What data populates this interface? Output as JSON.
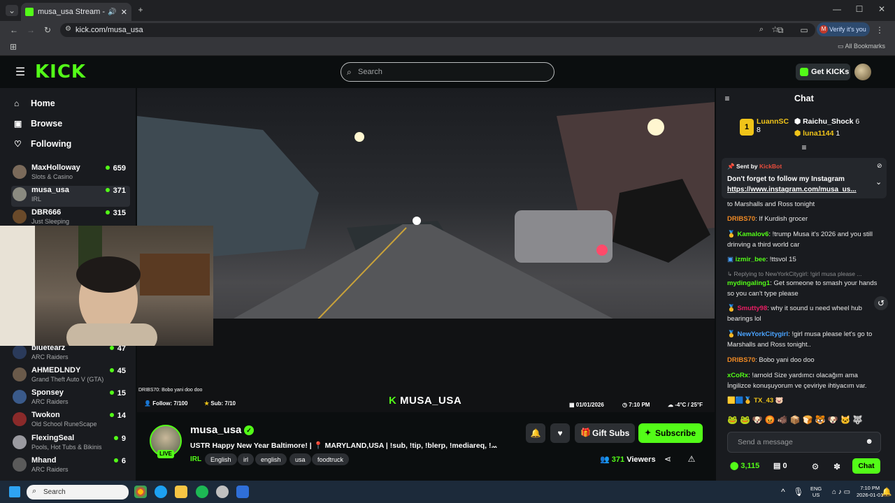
{
  "browser": {
    "tab_title": "musa_usa Stream - Watch L",
    "url": "kick.com/musa_usa",
    "verify_label": "Verify it's you",
    "verify_avatar": "M",
    "bookmarks_label": "All Bookmarks"
  },
  "header": {
    "logo": "KICK",
    "search_placeholder": "Search",
    "get_kicks": "Get KICKs"
  },
  "sidebar": {
    "nav": [
      {
        "label": "Home",
        "icon": "home-icon"
      },
      {
        "label": "Browse",
        "icon": "browse-icon"
      },
      {
        "label": "Following",
        "icon": "heart-icon"
      }
    ],
    "channels_top": [
      {
        "name": "MaxHolloway",
        "category": "Slots & Casino",
        "viewers": "659"
      },
      {
        "name": "musa_usa",
        "category": "IRL",
        "viewers": "371"
      },
      {
        "name": "DBR666",
        "category": "Just Sleeping",
        "viewers": "315"
      }
    ],
    "channels_bottom": [
      {
        "name": "bluetearz",
        "category": "ARC Raiders",
        "viewers": "47"
      },
      {
        "name": "AHMEDLNDY",
        "category": "Grand Theft Auto V (GTA)",
        "viewers": "45"
      },
      {
        "name": "Sponsey",
        "category": "ARC Raiders",
        "viewers": "15"
      },
      {
        "name": "Twokon",
        "category": "Old School RuneScape",
        "viewers": "14"
      },
      {
        "name": "FlexingSeal",
        "category": "Pools, Hot Tubs & Bikinis",
        "viewers": "9"
      },
      {
        "name": "Mhand",
        "category": "ARC Raiders",
        "viewers": "6"
      }
    ]
  },
  "video_overlay": {
    "chat_line": "DRIBS70: Bobo yani doo doo",
    "follow": "Follow: 7/100",
    "sub": "Sub: 7/10",
    "name": "MUSA_USA",
    "date": "01/01/2026",
    "time": "7:10 PM",
    "temp": "-4°C / 25°F"
  },
  "stream": {
    "name": "musa_usa",
    "live": "LIVE",
    "title": "USTR Happy New Year Baltimore! | 📍 MARYLAND,USA | !sub, !tip, !blerp, !mediareq, !...",
    "category": "IRL",
    "tags": [
      "English",
      "irl",
      "english",
      "usa",
      "foodtruck"
    ],
    "gift_subs": "Gift Subs",
    "subscribe": "Subscribe",
    "viewers": "371",
    "viewers_label": "Viewers"
  },
  "chat": {
    "title": "Chat",
    "leaderboard": [
      {
        "name": "LuannSC",
        "count": "8",
        "color": "#f0c419"
      },
      {
        "name": "Raichu_Shock",
        "count": "6",
        "color": "#ffffff"
      },
      {
        "name": "luna1144",
        "count": "1",
        "color": "#f0c419"
      }
    ],
    "pinned": {
      "sent_by": "Sent by",
      "bot": "KickBot",
      "text": "Don't forget to follow my Instagram",
      "link": "https://www.instagram.com/musa_us..."
    },
    "messages": [
      {
        "user": "",
        "color": "#e8e8e8",
        "text": "to Marshalls and Ross tonight"
      },
      {
        "user": "DRIBS70",
        "color": "#f08a24",
        "text": "If Kurdish grocer"
      },
      {
        "user": "Kamalov6",
        "color": "#53fc18",
        "text": "!trump Musa it's 2026 and you still drinving a third world car"
      },
      {
        "user": "izmir_bee",
        "color": "#53fc18",
        "text": "!ttsvol 15"
      },
      {
        "user": "mydingaling1",
        "color": "#53fc18",
        "text": "Get someone to smash your hands so you can't type please",
        "reply": "Replying to NewYorkCitygirl: !girl musa please ..."
      },
      {
        "user": "Smutty98",
        "color": "#e91e63",
        "text": "why it sound u need wheel hub bearings lol"
      },
      {
        "user": "NewYorkCitygirl",
        "color": "#4aa3ff",
        "text": "!girl musa please let's go to Marshalls and Ross tonight.."
      },
      {
        "user": "DRIBS70",
        "color": "#f08a24",
        "text": "Bobo yani doo doo"
      },
      {
        "user": "xCoRx",
        "color": "#53fc18",
        "text": "!arnold Size yardımcı olacağım ama İngilizce konuşuyorum ve çeviriye ihtiyacım var."
      },
      {
        "user": "TX_43",
        "color": "#f0c419",
        "text": ""
      }
    ],
    "input_placeholder": "Send a message",
    "points": "3,115",
    "drops": "0",
    "send": "Chat"
  },
  "taskbar": {
    "search": "Search",
    "lang1": "ENG",
    "lang2": "US",
    "time": "7:10 PM",
    "date": "2026-01-01"
  }
}
